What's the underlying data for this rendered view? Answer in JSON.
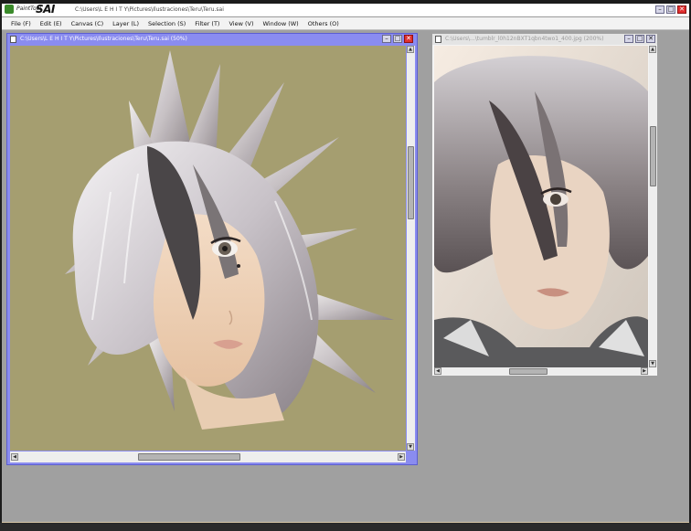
{
  "app": {
    "brand_small": "PaintTool",
    "brand_big": "SAI",
    "path": "C:\\Users\\L E H I T Y\\Pictures\\Ilustraciones\\Teru\\Teru.sai"
  },
  "menu": [
    {
      "id": "file",
      "label": "File (F)"
    },
    {
      "id": "edit",
      "label": "Edit (E)"
    },
    {
      "id": "canvas",
      "label": "Canvas (C)"
    },
    {
      "id": "layer",
      "label": "Layer (L)"
    },
    {
      "id": "selection",
      "label": "Selection (S)"
    },
    {
      "id": "filter",
      "label": "Filter (T)"
    },
    {
      "id": "view",
      "label": "View (V)"
    },
    {
      "id": "window",
      "label": "Window (W)"
    },
    {
      "id": "others",
      "label": "Others (O)"
    }
  ],
  "windows": {
    "canvas1": {
      "title": "C:\\Users\\L E H I T Y\\Pictures\\Ilustraciones\\Teru\\Teru.sai (50%)",
      "bg": "#a59e70",
      "frame": "#8a8cf0"
    },
    "canvas2": {
      "title": "C:\\Users\\...\\tumblr_l0h12nBXT1qbn4two1_400.jpg (200%)"
    }
  },
  "icons": {
    "minimize": "minimize-icon",
    "maximize": "maximize-icon",
    "close": "close-icon"
  },
  "glyphs": {
    "minimize": "–",
    "maximize": "□",
    "close": "✕",
    "up": "▲",
    "down": "▼",
    "left": "◀",
    "right": "▶"
  },
  "colors": {
    "workspace": "#a0a0a0",
    "active_frame": "#8a8cf0",
    "canvas_bg": "#a59e70",
    "close_button": "#e03030"
  }
}
